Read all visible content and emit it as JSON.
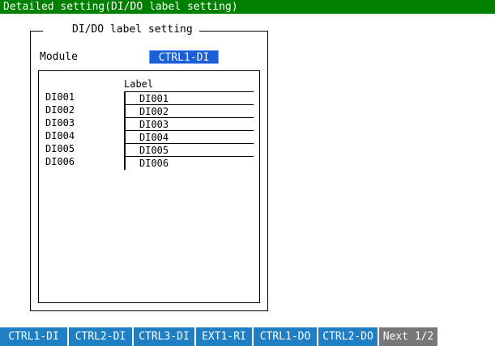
{
  "title_bar": "Detailed setting(DI/DO label setting)",
  "group": {
    "title": "DI/DO label setting",
    "module_label": "Module",
    "module_value": "CTRL1-DI"
  },
  "table": {
    "header": "Label",
    "rows": [
      {
        "name": "DI001",
        "value": "DI001"
      },
      {
        "name": "DI002",
        "value": "DI002"
      },
      {
        "name": "DI003",
        "value": "DI003"
      },
      {
        "name": "DI004",
        "value": "DI004"
      },
      {
        "name": "DI005",
        "value": "DI005"
      },
      {
        "name": "DI006",
        "value": "DI006"
      }
    ]
  },
  "softkeys": [
    "CTRL1-DI",
    "CTRL2-DI",
    "CTRL3-DI",
    "EXT1-RI",
    "CTRL1-DO",
    "CTRL2-DO",
    "Next 1/2"
  ],
  "colors": {
    "title_bar": "#008000",
    "selected_field": "#1a5fd8",
    "softkey": "#1e7fc4",
    "softkey_next": "#777777"
  }
}
